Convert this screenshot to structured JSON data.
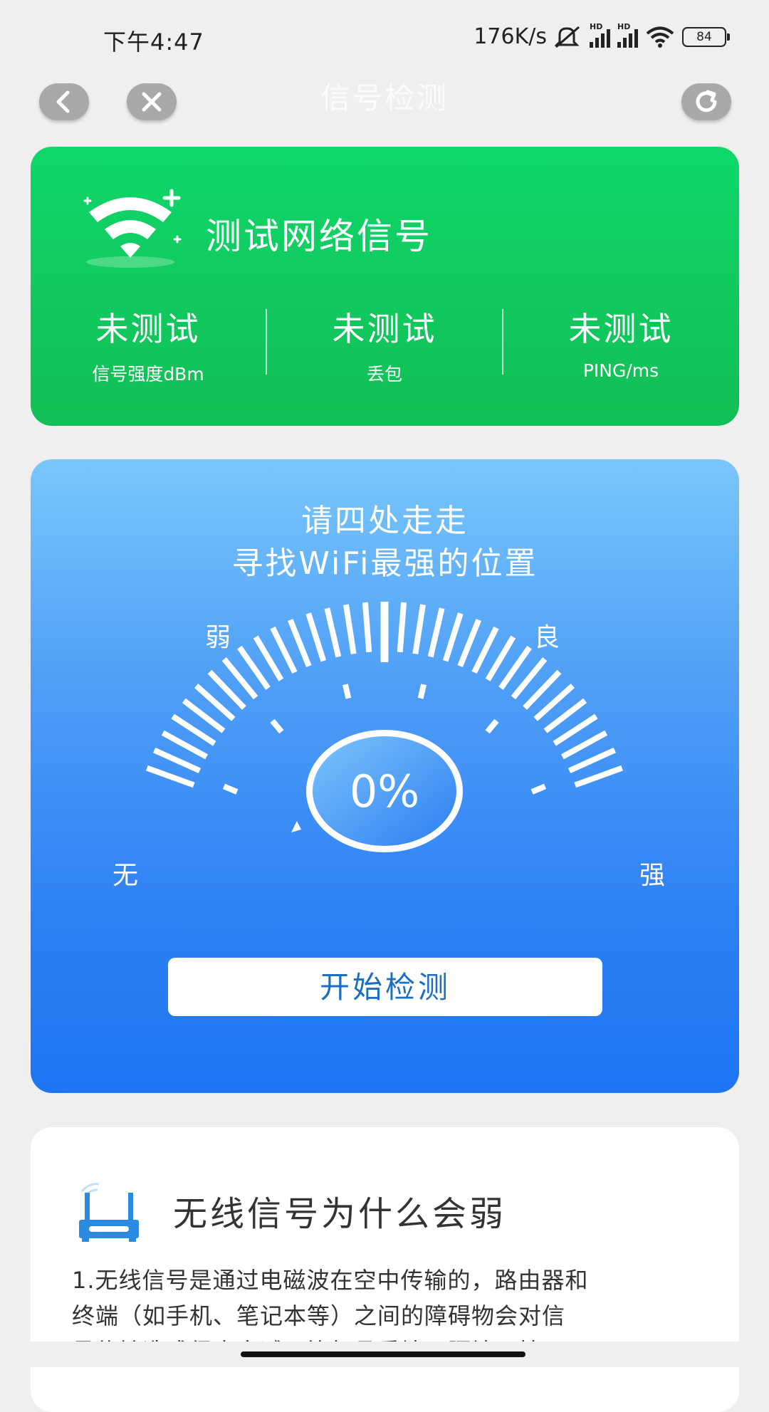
{
  "status_bar": {
    "time": "下午4:47",
    "net_speed": "176K/s",
    "signal_label": "HD",
    "battery": "84"
  },
  "header": {
    "title": "信号检测",
    "icons": {
      "back": "back-icon",
      "close": "close-icon",
      "refresh": "refresh-icon"
    }
  },
  "summary_card": {
    "title": "测试网络信号",
    "metrics": [
      {
        "value": "未测试",
        "label": "信号强度dBm"
      },
      {
        "value": "未测试",
        "label": "丢包"
      },
      {
        "value": "未测试",
        "label": "PING/ms"
      }
    ],
    "color": "#12c95c"
  },
  "gauge_card": {
    "tip_line1": "请四处走走",
    "tip_line2": "寻找WiFi最强的位置",
    "level_labels": {
      "none": "无",
      "weak": "弱",
      "good": "良",
      "strong": "强"
    },
    "percent_text": "0%",
    "percent_value": 0,
    "start_button": "开始检测"
  },
  "info_card": {
    "title": "无线信号为什么会弱",
    "body_line1": "1.无线信号是通过电磁波在空中传输的，路由器和",
    "body_line2": "终端（如手机、笔记本等）之间的障碍物会对信",
    "body_line3": "号传输造成很大衰减，比如承重墙、隔墙、挡"
  }
}
